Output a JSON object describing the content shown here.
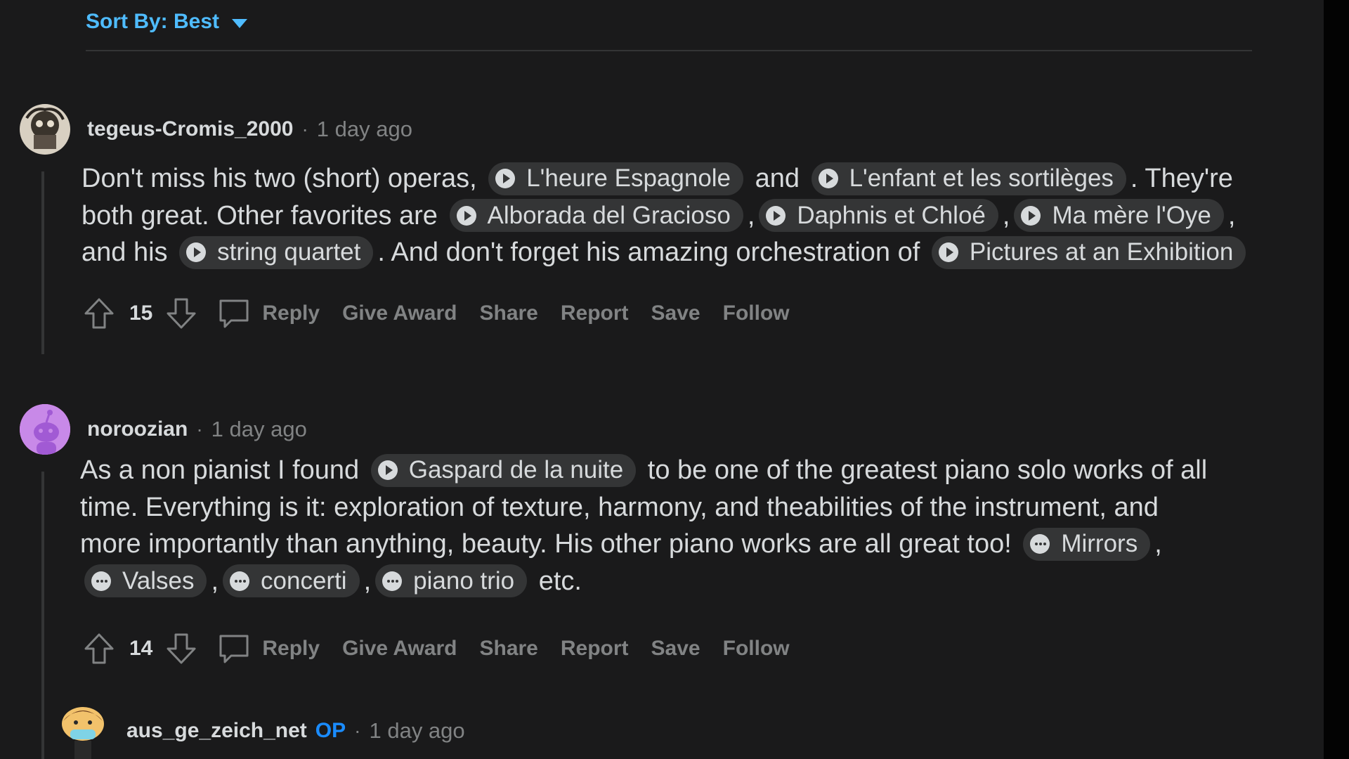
{
  "sort": {
    "label": "Sort By: Best"
  },
  "comments": [
    {
      "username": "tegeus-Cromis_2000",
      "time": "1 day ago",
      "score": "15",
      "lines": [
        [
          {
            "t": "Don't miss his two (short) operas, "
          },
          {
            "chip": "L'heure Espagnole",
            "icon": "play"
          },
          {
            "t": " and "
          },
          {
            "chip": "L'enfant et les sortilèges",
            "icon": "play"
          },
          {
            "t": ". They're"
          }
        ],
        [
          {
            "t": "both great. Other favorites are "
          },
          {
            "chip": "Alborada del Gracioso",
            "icon": "play"
          },
          {
            "t": ","
          },
          {
            "chip": "Daphnis et Chloé",
            "icon": "play"
          },
          {
            "t": ","
          },
          {
            "chip": "Ma mère l'Oye",
            "icon": "play"
          },
          {
            "t": ","
          }
        ],
        [
          {
            "t": "and his "
          },
          {
            "chip": "string quartet",
            "icon": "play"
          },
          {
            "t": ". And don't forget his amazing orchestration of "
          },
          {
            "chip": "Pictures at an Exhibition",
            "icon": "play"
          }
        ]
      ]
    },
    {
      "username": "noroozian",
      "time": "1 day ago",
      "score": "14",
      "lines": [
        [
          {
            "t": "As a non pianist I found "
          },
          {
            "chip": "Gaspard de la nuite",
            "icon": "play"
          },
          {
            "t": " to be one of the greatest piano solo works of all"
          }
        ],
        [
          {
            "t": "time. Everything is it: exploration of texture, harmony, and theabilities of the instrument, and"
          }
        ],
        [
          {
            "t": "more importantly than anything, beauty. His other piano works are all great too! "
          },
          {
            "chip": "Mirrors",
            "icon": "more"
          },
          {
            "t": ","
          }
        ],
        [
          {
            "chip": "Valses",
            "icon": "more"
          },
          {
            "t": ","
          },
          {
            "chip": "concerti",
            "icon": "more"
          },
          {
            "t": ","
          },
          {
            "chip": "piano trio",
            "icon": "more"
          },
          {
            "t": " etc."
          }
        ]
      ]
    },
    {
      "username": "aus_ge_zeich_net",
      "op": "OP",
      "time": "1 day ago"
    }
  ],
  "actions": {
    "reply": "Reply",
    "give_award": "Give Award",
    "share": "Share",
    "report": "Report",
    "save": "Save",
    "follow": "Follow"
  },
  "separator": "·",
  "colors": {
    "background": "#1a1a1b",
    "text": "#d7dadc",
    "muted": "#818384",
    "accent": "#4fbcff",
    "chip": "#343536"
  }
}
